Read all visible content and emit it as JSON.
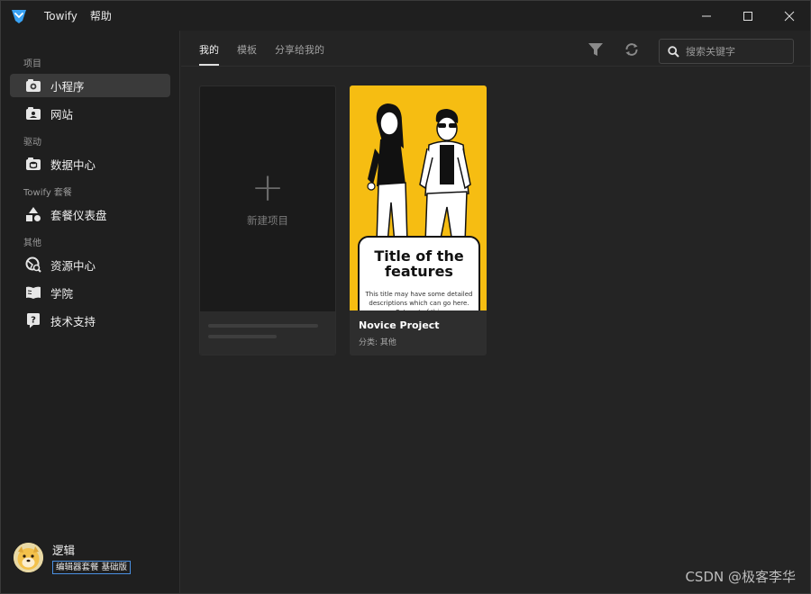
{
  "titlebar": {
    "menu": [
      "Towify",
      "帮助"
    ]
  },
  "sidebar": {
    "sections": [
      {
        "title": "项目",
        "items": [
          {
            "label": "小程序",
            "icon": "mini-program-icon",
            "active": true
          },
          {
            "label": "网站",
            "icon": "website-icon",
            "active": false
          }
        ]
      },
      {
        "title": "驱动",
        "items": [
          {
            "label": "数据中心",
            "icon": "database-icon",
            "active": false
          }
        ]
      },
      {
        "title": "Towify 套餐",
        "items": [
          {
            "label": "套餐仪表盘",
            "icon": "shapes-icon",
            "active": false
          }
        ]
      },
      {
        "title": "其他",
        "items": [
          {
            "label": "资源中心",
            "icon": "resource-icon",
            "active": false
          },
          {
            "label": "学院",
            "icon": "book-icon",
            "active": false
          },
          {
            "label": "技术支持",
            "icon": "help-icon",
            "active": false
          }
        ]
      }
    ]
  },
  "user": {
    "name": "逻辑",
    "plan": "编辑器套餐 基础版"
  },
  "tabs": [
    "我的",
    "模板",
    "分享给我的"
  ],
  "search": {
    "placeholder": "搜索关键字"
  },
  "cards": {
    "new_label": "新建项目",
    "project": {
      "feature_title": "Title of the features",
      "feature_desc": "This title may have some detailed descriptions which can go here. Put part of this",
      "title": "Novice Project",
      "category": "分类: 其他"
    }
  },
  "watermark": "CSDN @极客李华",
  "colors": {
    "accent_yellow": "#f6bd12",
    "logo_blue": "#3aa3f5",
    "active_nav": "#3a3a3a"
  }
}
